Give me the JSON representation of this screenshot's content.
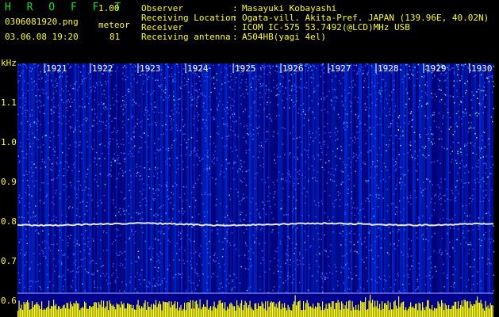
{
  "app": {
    "title": "H R O F F T",
    "version": "1.00",
    "filename": "0306081920.png",
    "mode": "meteor",
    "datetime": "03.06.08 19:20",
    "count": "81"
  },
  "info": [
    {
      "label": "Observer",
      "value": "Masayuki Kobayashi"
    },
    {
      "label": "Receiving Location",
      "value": "Ogata-vill. Akita-Pref. JAPAN (139.96E, 40.02N)"
    },
    {
      "label": "Receiver",
      "value": "ICOM IC-575 53.7492(@LCD)MHz USB"
    },
    {
      "label": "Receiving antenna",
      "value": "A504HB(yagi 4el)"
    }
  ],
  "axis": {
    "unit": "kHz",
    "ticks": [
      "1.1",
      "1.0",
      "0.9",
      "0.8",
      "0.7",
      "0.6"
    ]
  },
  "time_marks": [
    "1921",
    "1922",
    "1923",
    "1924",
    "1925",
    "1926",
    "1927",
    "1928",
    "1929",
    "1930"
  ],
  "colors": {
    "background": "#000000",
    "noise_base": "#00008c",
    "text": "#ffff00",
    "title": "#10e020",
    "signal_line": "#ffffff"
  }
}
